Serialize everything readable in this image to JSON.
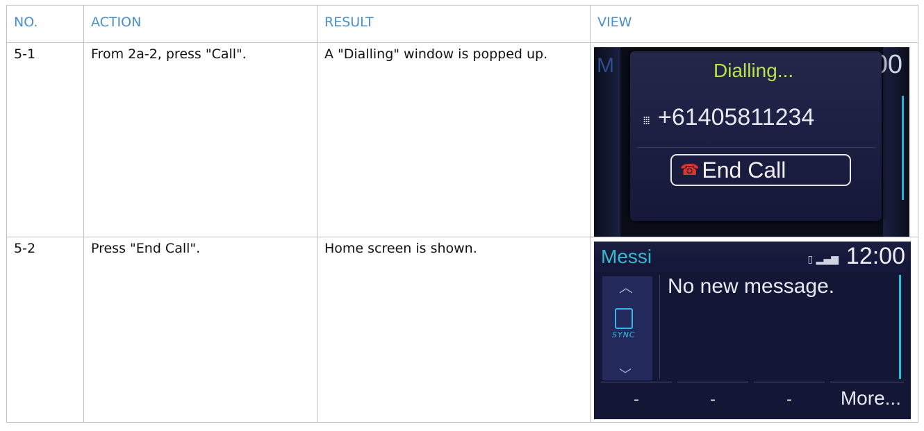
{
  "columns": {
    "no": "NO.",
    "action": "ACTION",
    "result": "RESULT",
    "view": "VIEW"
  },
  "rows": [
    {
      "no": "5-1",
      "action": "From 2a-2, press \"Call\".",
      "result": "A \"Dialling\" window is popped up.",
      "view": {
        "title": "Dialling...",
        "number": "+61405811234",
        "end_call": "End Call",
        "ghost_time": "12:00",
        "ghost_letter": "M"
      }
    },
    {
      "no": "5-2",
      "action": "Press \"End Call\".",
      "result": "Home screen is shown.",
      "view": {
        "app": "Messi",
        "time": "12:00",
        "message": "No new message.",
        "brand": "SYNC",
        "softkeys": [
          "-",
          "-",
          "-",
          "More..."
        ]
      }
    }
  ],
  "colors": {
    "header_text": "#4a8fc8",
    "border": "#bfbfbf",
    "dialling_title": "#b8e24a",
    "app_title": "#36b8d0"
  }
}
